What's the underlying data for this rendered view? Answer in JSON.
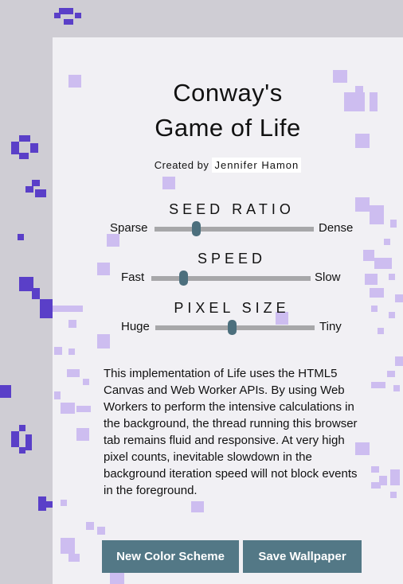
{
  "title": {
    "line1": "Conway's",
    "line2": "Game of Life"
  },
  "credit": {
    "prefix": "Created by",
    "author": "Jennifer Hamon"
  },
  "controls": {
    "seed_ratio": {
      "label": "SEED RATIO",
      "min_label": "Sparse",
      "max_label": "Dense",
      "value": 0.26
    },
    "speed": {
      "label": "SPEED",
      "min_label": "Fast",
      "max_label": "Slow",
      "value": 0.2
    },
    "pixel_size": {
      "label": "PIXEL SIZE",
      "min_label": "Huge",
      "max_label": "Tiny",
      "value": 0.48
    }
  },
  "description": "This implementation of Life uses the HTML5 Canvas and Web Worker APIs. By using Web Workers to perform the intensive calculations in the background, the thread running this browser tab remains fluid and responsive. At very high pixel counts, inevitable slowdown in the background iteration speed will not block events in the foreground.",
  "buttons": {
    "new_color_scheme": "New Color Scheme",
    "save_wallpaper": "Save Wallpaper"
  },
  "colors": {
    "outer_background": "#cfcdd4",
    "panel_background": "#f1f0f4",
    "cell_dark": "#5a3fc8",
    "cell_light": "#cdbdf0",
    "slider_track": "#a7a7a9",
    "slider_thumb": "#4c6f7d",
    "button": "#537886"
  }
}
